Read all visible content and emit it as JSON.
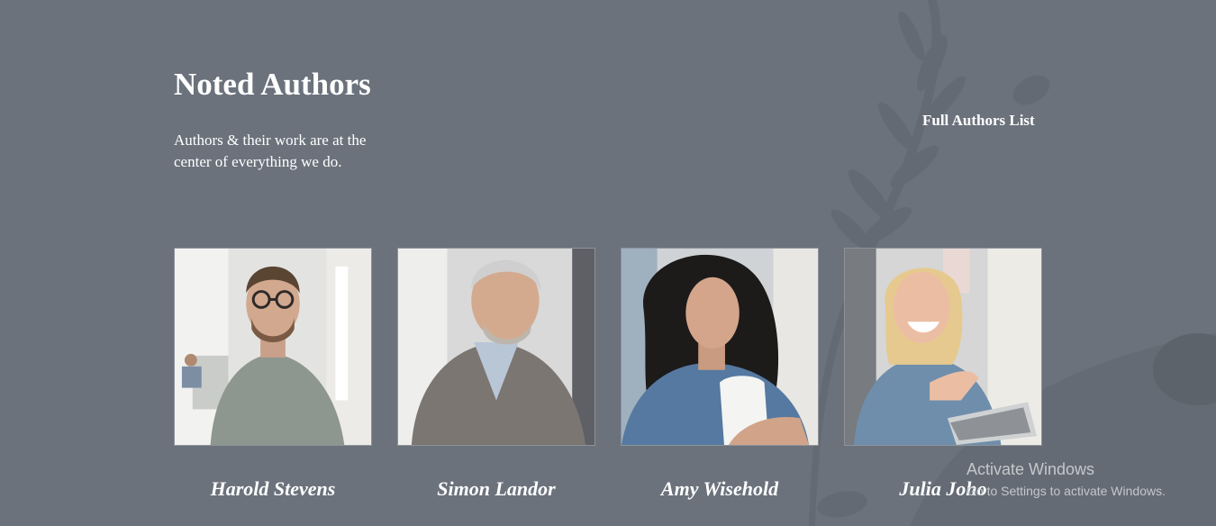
{
  "header": {
    "title": "Noted Authors",
    "subtitle": "Authors & their work are at the center of everything we do.",
    "full_list_link": "Full Authors List"
  },
  "authors": [
    {
      "name": "Harold Stevens"
    },
    {
      "name": "Simon Landor"
    },
    {
      "name": "Amy Wisehold"
    },
    {
      "name": "Julia Joho"
    }
  ],
  "watermark": {
    "title": "Activate Windows",
    "subtitle": "Go to Settings to activate Windows."
  },
  "colors": {
    "background": "#6b727c",
    "text": "#ffffff",
    "watermark": "#c4c8cd"
  }
}
